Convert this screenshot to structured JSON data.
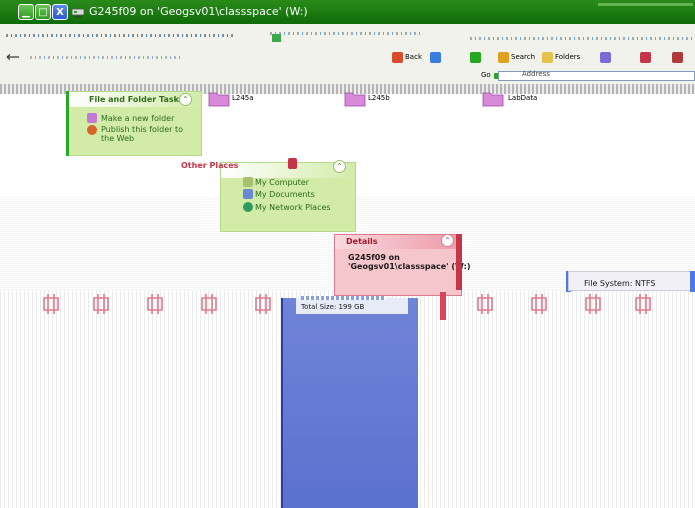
{
  "window": {
    "title": "G245f09 on 'Geogsv01\\classspace' (W:)",
    "minimize_glyph": "▁",
    "maximize_glyph": "□",
    "close_glyph": "X"
  },
  "toolbar": {
    "back_label": "Back",
    "search_label": "Search",
    "folders_label": "Folders"
  },
  "address_bar": {
    "label": "Address",
    "go_label": "Go"
  },
  "file_folder_tasks": {
    "title": "File and Folder Tasks",
    "items": [
      {
        "label": "Make a new folder",
        "icon": "new-folder-icon"
      },
      {
        "label": "Publish this folder to the Web",
        "icon": "publish-web-icon"
      }
    ]
  },
  "other_places": {
    "title": "Other Places",
    "items": [
      {
        "label": "My Computer",
        "icon": "my-computer-icon"
      },
      {
        "label": "My Documents",
        "icon": "my-documents-icon"
      },
      {
        "label": "My Network Places",
        "icon": "my-network-places-icon"
      }
    ]
  },
  "folders": [
    {
      "name": "L245a"
    },
    {
      "name": "L245b"
    },
    {
      "name": "LabData"
    }
  ],
  "details": {
    "title": "Details",
    "name": "G245f09 on",
    "address": "'Geogsv01\\classspace' (W:)",
    "file_system": "File System: NTFS",
    "total_size": "Total Size: 199 GB"
  },
  "colors": {
    "title_bar": "#1f7f12",
    "task_panel": "#d2eca8",
    "details_panel": "#f5c6cc",
    "accent_blue": "#5b71cf"
  }
}
